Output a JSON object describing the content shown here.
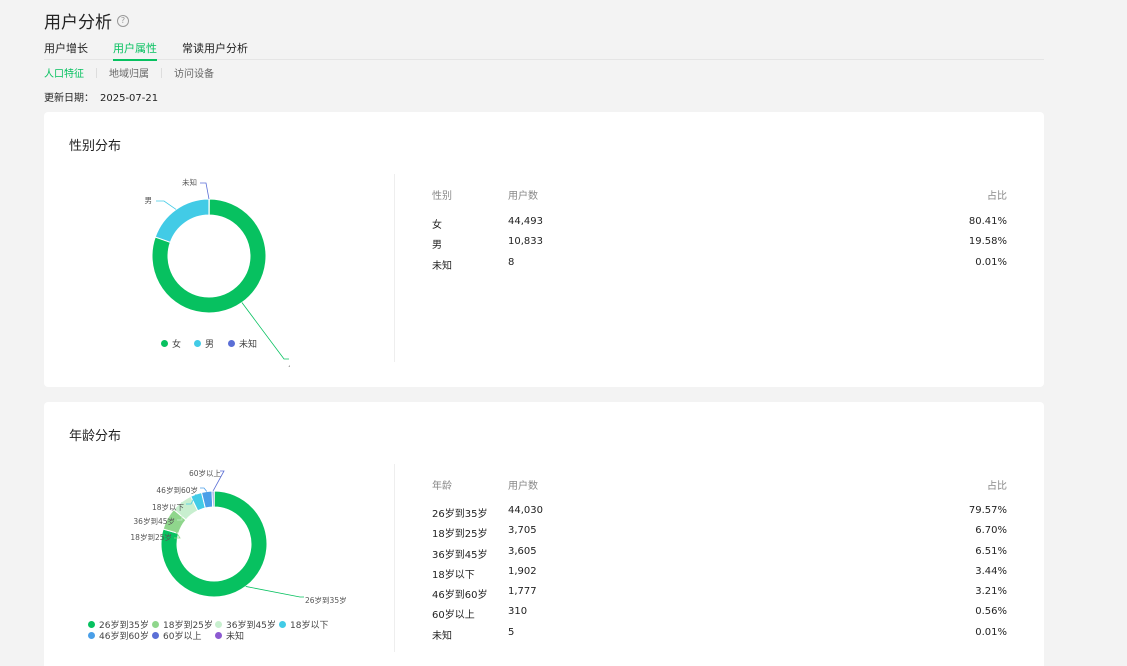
{
  "header": {
    "title": "用户分析",
    "help_glyph": "?"
  },
  "tabs": [
    "用户增长",
    "用户属性",
    "常读用户分析"
  ],
  "subtabs": [
    "人口特征",
    "地域归属",
    "访问设备"
  ],
  "update": {
    "label": "更新日期：",
    "date": "2025-07-21"
  },
  "gender": {
    "title": "性别分布",
    "table_headers": [
      "性别",
      "用户数",
      "占比"
    ],
    "rows": [
      {
        "name": "女",
        "count": "44,493",
        "pct": "80.41%"
      },
      {
        "name": "男",
        "count": "10,833",
        "pct": "19.58%"
      },
      {
        "name": "未知",
        "count": "8",
        "pct": "0.01%"
      }
    ]
  },
  "age": {
    "title": "年龄分布",
    "table_headers": [
      "年龄",
      "用户数",
      "占比"
    ],
    "rows": [
      {
        "name": "26岁到35岁",
        "count": "44,030",
        "pct": "79.57%"
      },
      {
        "name": "18岁到25岁",
        "count": "3,705",
        "pct": "6.70%"
      },
      {
        "name": "36岁到45岁",
        "count": "3,605",
        "pct": "6.51%"
      },
      {
        "name": "18岁以下",
        "count": "1,902",
        "pct": "3.44%"
      },
      {
        "name": "46岁到60岁",
        "count": "1,777",
        "pct": "3.21%"
      },
      {
        "name": "60岁以上",
        "count": "310",
        "pct": "0.56%"
      },
      {
        "name": "未知",
        "count": "5",
        "pct": "0.01%"
      }
    ]
  },
  "chart_data": [
    {
      "type": "pie",
      "title": "",
      "categories": [
        "女",
        "男",
        "未知"
      ],
      "values": [
        80.41,
        19.58,
        0.01
      ],
      "colors": [
        "#07c160",
        "#42cbe6",
        "#5b6fd6"
      ],
      "legend": "bottom"
    },
    {
      "type": "pie",
      "title": "",
      "categories": [
        "26岁到35岁",
        "18岁到25岁",
        "36岁到45岁",
        "18岁以下",
        "46岁到60岁",
        "60岁以上",
        "未知"
      ],
      "values": [
        79.57,
        6.7,
        6.51,
        3.44,
        3.21,
        0.56,
        0.01
      ],
      "colors": [
        "#07c160",
        "#8fd68c",
        "#c8efcf",
        "#42cbe6",
        "#4a9fe8",
        "#5b6fd6",
        "#8c5ad1"
      ],
      "legend": "bottom"
    }
  ]
}
